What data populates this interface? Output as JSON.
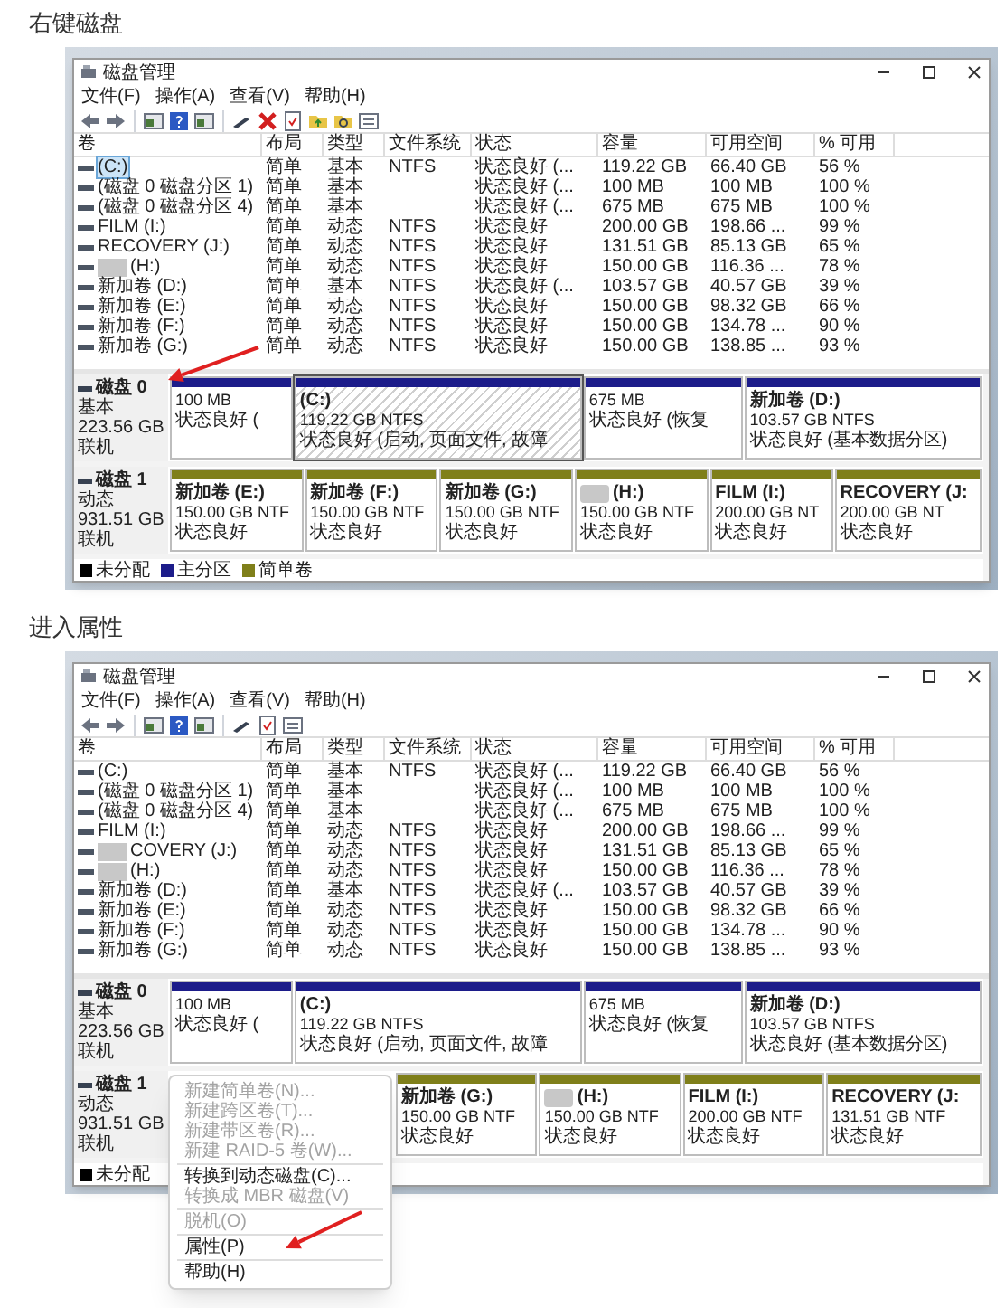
{
  "sections": [
    {
      "heading": "右键磁盘",
      "screenshot": {
        "window": {
          "title": "磁盘管理"
        },
        "menu": [
          "文件(F)",
          "操作(A)",
          "查看(V)",
          "帮助(H)"
        ],
        "toolbar": [
          {
            "kind": "back"
          },
          {
            "kind": "forward"
          },
          {
            "kind": "sep"
          },
          {
            "kind": "panel"
          },
          {
            "kind": "help"
          },
          {
            "kind": "panel"
          },
          {
            "kind": "sep"
          },
          {
            "kind": "pen"
          },
          {
            "kind": "delete"
          },
          {
            "kind": "doc"
          },
          {
            "kind": "folder"
          },
          {
            "kind": "folder-search"
          },
          {
            "kind": "list"
          }
        ],
        "columns": [
          "卷",
          "布局",
          "类型",
          "文件系统",
          "状态",
          "容量",
          "可用空间",
          "% 可用"
        ],
        "rows": [
          {
            "volume": "(C:)",
            "layout": "简单",
            "type": "基本",
            "filesystem": "NTFS",
            "status": "状态良好 (...",
            "capacity": "119.22 GB",
            "free": "66.40 GB",
            "percent": "56 %",
            "selected": true,
            "blurred": false
          },
          {
            "volume": "(磁盘 0 磁盘分区 1)",
            "layout": "简单",
            "type": "基本",
            "status": "状态良好 (...",
            "capacity": "100 MB",
            "free": "100 MB",
            "percent": "100 %",
            "selected": false,
            "blurred": false
          },
          {
            "volume": "(磁盘 0 磁盘分区 4)",
            "layout": "简单",
            "type": "基本",
            "status": "状态良好 (...",
            "capacity": "675 MB",
            "free": "675 MB",
            "percent": "100 %",
            "selected": false,
            "blurred": false
          },
          {
            "volume": "FILM (I:)",
            "layout": "简单",
            "type": "动态",
            "filesystem": "NTFS",
            "status": "状态良好",
            "capacity": "200.00 GB",
            "free": "198.66 ...",
            "percent": "99 %",
            "selected": false,
            "blurred": false
          },
          {
            "volume": "RECOVERY (J:)",
            "layout": "简单",
            "type": "动态",
            "filesystem": "NTFS",
            "status": "状态良好",
            "capacity": "131.51 GB",
            "free": "85.13 GB",
            "percent": "65 %",
            "selected": false,
            "blurred": false
          },
          {
            "volume": "(H:)",
            "layout": "简单",
            "type": "动态",
            "filesystem": "NTFS",
            "status": "状态良好",
            "capacity": "150.00 GB",
            "free": "116.36 ...",
            "percent": "78 %",
            "selected": false,
            "blurred": true
          },
          {
            "volume": "新加卷 (D:)",
            "layout": "简单",
            "type": "基本",
            "filesystem": "NTFS",
            "status": "状态良好 (...",
            "capacity": "103.57 GB",
            "free": "40.57 GB",
            "percent": "39 %",
            "selected": false,
            "blurred": false
          },
          {
            "volume": "新加卷 (E:)",
            "layout": "简单",
            "type": "动态",
            "filesystem": "NTFS",
            "status": "状态良好",
            "capacity": "150.00 GB",
            "free": "98.32 GB",
            "percent": "66 %",
            "selected": false,
            "blurred": false
          },
          {
            "volume": "新加卷 (F:)",
            "layout": "简单",
            "type": "动态",
            "filesystem": "NTFS",
            "status": "状态良好",
            "capacity": "150.00 GB",
            "free": "134.78 ...",
            "percent": "90 %",
            "selected": false,
            "blurred": false
          },
          {
            "volume": "新加卷 (G:)",
            "layout": "简单",
            "type": "动态",
            "filesystem": "NTFS",
            "status": "状态良好",
            "capacity": "150.00 GB",
            "free": "138.85 ...",
            "percent": "93 %",
            "selected": false,
            "blurred": false
          }
        ],
        "disks": [
          {
            "label": "磁盘 0",
            "type": "基本",
            "size": "223.56 GB",
            "status": "联机",
            "partitions": [
              {
                "size": "100 MB",
                "status": "状态良好 (",
                "color": "#1c1c8a",
                "selected": false,
                "blurred": false
              },
              {
                "name": "(C:)",
                "size": "119.22 GB NTFS",
                "status": "状态良好 (启动, 页面文件, 故障",
                "color": "#1c1c8a",
                "selected": true,
                "blurred": false
              },
              {
                "size": "675 MB",
                "status": "状态良好 (恢复",
                "color": "#1c1c8a",
                "selected": false,
                "blurred": false
              },
              {
                "name": "新加卷 (D:)",
                "size": "103.57 GB NTFS",
                "status": "状态良好 (基本数据分区)",
                "color": "#1c1c8a",
                "selected": false,
                "blurred": false
              }
            ]
          },
          {
            "label": "磁盘 1",
            "type": "动态",
            "size": "931.51 GB",
            "status": "联机",
            "partitions": [
              {
                "name": "新加卷 (E:)",
                "size": "150.00 GB NTF",
                "status": "状态良好",
                "color": "#7f7f1a",
                "selected": false,
                "blurred": false
              },
              {
                "name": "新加卷 (F:)",
                "size": "150.00 GB NTF",
                "status": "状态良好",
                "color": "#7f7f1a",
                "selected": false,
                "blurred": false
              },
              {
                "name": "新加卷 (G:)",
                "size": "150.00 GB NTF",
                "status": "状态良好",
                "color": "#7f7f1a",
                "selected": false,
                "blurred": false
              },
              {
                "name": "(H:)",
                "size": "150.00 GB NTF",
                "status": "状态良好",
                "color": "#7f7f1a",
                "selected": false,
                "blurred": true
              },
              {
                "name": "FILM (I:)",
                "size": "200.00 GB NT",
                "status": "状态良好",
                "color": "#7f7f1a",
                "selected": false,
                "blurred": false
              },
              {
                "name": "RECOVERY (J:",
                "size": "200.00 GB NT",
                "status": "状态良好",
                "color": "#7f7f1a",
                "selected": false,
                "blurred": false
              }
            ]
          }
        ],
        "legend": [
          {
            "label": "未分配",
            "color": "#000000"
          },
          {
            "label": "主分区",
            "color": "#1c1c8a"
          },
          {
            "label": "简单卷",
            "color": "#7f7f1a"
          }
        ]
      }
    },
    {
      "heading": "进入属性",
      "screenshot": {
        "window": {
          "title": "磁盘管理"
        },
        "menu": [
          "文件(F)",
          "操作(A)",
          "查看(V)",
          "帮助(H)"
        ],
        "toolbar": [
          {
            "kind": "back"
          },
          {
            "kind": "forward"
          },
          {
            "kind": "sep"
          },
          {
            "kind": "panel"
          },
          {
            "kind": "help"
          },
          {
            "kind": "panel"
          },
          {
            "kind": "sep"
          },
          {
            "kind": "pen"
          },
          {
            "kind": "doc"
          },
          {
            "kind": "list"
          }
        ],
        "columns": [
          "卷",
          "布局",
          "类型",
          "文件系统",
          "状态",
          "容量",
          "可用空间",
          "% 可用"
        ],
        "rows": [
          {
            "volume": "(C:)",
            "layout": "简单",
            "type": "基本",
            "filesystem": "NTFS",
            "status": "状态良好 (...",
            "capacity": "119.22 GB",
            "free": "66.40 GB",
            "percent": "56 %",
            "selected": false,
            "blurred": false
          },
          {
            "volume": "(磁盘 0 磁盘分区 1)",
            "layout": "简单",
            "type": "基本",
            "status": "状态良好 (...",
            "capacity": "100 MB",
            "free": "100 MB",
            "percent": "100 %",
            "selected": false,
            "blurred": false
          },
          {
            "volume": "(磁盘 0 磁盘分区 4)",
            "layout": "简单",
            "type": "基本",
            "status": "状态良好 (...",
            "capacity": "675 MB",
            "free": "675 MB",
            "percent": "100 %",
            "selected": false,
            "blurred": false
          },
          {
            "volume": "FILM (I:)",
            "layout": "简单",
            "type": "动态",
            "filesystem": "NTFS",
            "status": "状态良好",
            "capacity": "200.00 GB",
            "free": "198.66 ...",
            "percent": "99 %",
            "selected": false,
            "blurred": false
          },
          {
            "volume": "COVERY (J:)",
            "layout": "简单",
            "type": "动态",
            "filesystem": "NTFS",
            "status": "状态良好",
            "capacity": "131.51 GB",
            "free": "85.13 GB",
            "percent": "65 %",
            "selected": false,
            "blurred": true
          },
          {
            "volume": "(H:)",
            "layout": "简单",
            "type": "动态",
            "filesystem": "NTFS",
            "status": "状态良好",
            "capacity": "150.00 GB",
            "free": "116.36 ...",
            "percent": "78 %",
            "selected": false,
            "blurred": true
          },
          {
            "volume": "新加卷 (D:)",
            "layout": "简单",
            "type": "基本",
            "filesystem": "NTFS",
            "status": "状态良好 (...",
            "capacity": "103.57 GB",
            "free": "40.57 GB",
            "percent": "39 %",
            "selected": false,
            "blurred": false
          },
          {
            "volume": "新加卷 (E:)",
            "layout": "简单",
            "type": "动态",
            "filesystem": "NTFS",
            "status": "状态良好",
            "capacity": "150.00 GB",
            "free": "98.32 GB",
            "percent": "66 %",
            "selected": false,
            "blurred": false
          },
          {
            "volume": "新加卷 (F:)",
            "layout": "简单",
            "type": "动态",
            "filesystem": "NTFS",
            "status": "状态良好",
            "capacity": "150.00 GB",
            "free": "134.78 ...",
            "percent": "90 %",
            "selected": false,
            "blurred": false
          },
          {
            "volume": "新加卷 (G:)",
            "layout": "简单",
            "type": "动态",
            "filesystem": "NTFS",
            "status": "状态良好",
            "capacity": "150.00 GB",
            "free": "138.85 ...",
            "percent": "93 %",
            "selected": false,
            "blurred": false
          }
        ],
        "disks": [
          {
            "label": "磁盘 0",
            "type": "基本",
            "size": "223.56 GB",
            "status": "联机",
            "partitions": [
              {
                "size": "100 MB",
                "status": "状态良好 (",
                "color": "#1c1c8a",
                "selected": false,
                "blurred": false
              },
              {
                "name": "(C:)",
                "size": "119.22 GB NTFS",
                "status": "状态良好 (启动, 页面文件, 故障",
                "color": "#1c1c8a",
                "selected": false,
                "blurred": false
              },
              {
                "size": "675 MB",
                "status": "状态良好 (恢复",
                "color": "#1c1c8a",
                "selected": false,
                "blurred": false
              },
              {
                "name": "新加卷 (D:)",
                "size": "103.57 GB NTFS",
                "status": "状态良好 (基本数据分区)",
                "color": "#1c1c8a",
                "selected": false,
                "blurred": false
              }
            ]
          },
          {
            "label": "磁盘 1",
            "type": "动态",
            "size": "931.51 GB",
            "status": "联机",
            "partitions": [
              {
                "name": "新加卷 (G:)",
                "size": "150.00 GB NTF",
                "status": "状态良好",
                "color": "#7f7f1a",
                "selected": false,
                "blurred": false
              },
              {
                "name": "(H:)",
                "size": "150.00 GB NTF",
                "status": "状态良好",
                "color": "#7f7f1a",
                "selected": false,
                "blurred": true
              },
              {
                "name": "FILM (I:)",
                "size": "200.00 GB NTF",
                "status": "状态良好",
                "color": "#7f7f1a",
                "selected": false,
                "blurred": false
              },
              {
                "name": "RECOVERY (J:",
                "size": "131.51 GB NTF",
                "status": "状态良好",
                "color": "#7f7f1a",
                "selected": false,
                "blurred": false
              }
            ]
          }
        ],
        "legend": [
          {
            "label": "未分配",
            "color": "#000000"
          }
        ],
        "context_menu": {
          "items": [
            {
              "kind": "item",
              "label": "新建简单卷(N)...",
              "disabled": true
            },
            {
              "kind": "item",
              "label": "新建跨区卷(T)...",
              "disabled": true
            },
            {
              "kind": "item",
              "label": "新建带区卷(R)...",
              "disabled": true
            },
            {
              "kind": "item",
              "label": "新建 RAID-5 卷(W)...",
              "disabled": true
            },
            {
              "kind": "separator"
            },
            {
              "kind": "item",
              "label": "转换到动态磁盘(C)...",
              "disabled": false
            },
            {
              "kind": "item",
              "label": "转换成 MBR 磁盘(V)",
              "disabled": true
            },
            {
              "kind": "separator"
            },
            {
              "kind": "item",
              "label": "脱机(O)",
              "disabled": true
            },
            {
              "kind": "separator"
            },
            {
              "kind": "item",
              "label": "属性(P)",
              "disabled": false
            },
            {
              "kind": "separator"
            },
            {
              "kind": "item",
              "label": "帮助(H)",
              "disabled": false
            }
          ]
        }
      }
    }
  ]
}
